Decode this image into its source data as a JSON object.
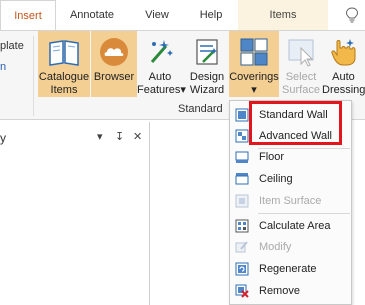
{
  "tabs": [
    {
      "label": "Insert",
      "active": true
    },
    {
      "label": "Annotate"
    },
    {
      "label": "View"
    },
    {
      "label": "Help"
    },
    {
      "label": "Items"
    }
  ],
  "left_stub": {
    "line1": "plate",
    "line2": "n"
  },
  "ribbon": {
    "buttons": [
      {
        "label": "Catalogue\nItems"
      },
      {
        "label": "Browser"
      },
      {
        "label": "Auto\nFeatures▾"
      },
      {
        "label": "Design\nWizard"
      },
      {
        "label": "Coverings\n▾"
      },
      {
        "label": "Select\nSurface"
      },
      {
        "label": "Auto\nDressing"
      }
    ],
    "group_label": "Standard"
  },
  "panel": {
    "title": "y",
    "tools": [
      "▾",
      "↧",
      "✕"
    ]
  },
  "menu": {
    "items": [
      {
        "label": "Standard Wall",
        "icon": "standard-wall-icon"
      },
      {
        "label": "Advanced Wall",
        "icon": "advanced-wall-icon"
      },
      {
        "label": "Floor",
        "icon": "floor-icon"
      },
      {
        "label": "Ceiling",
        "icon": "ceiling-icon"
      },
      {
        "label": "Item Surface",
        "icon": "item-surface-icon",
        "disabled": true
      },
      {
        "label": "Calculate Area",
        "icon": "calculate-area-icon"
      },
      {
        "label": "Modify",
        "icon": "modify-icon",
        "disabled": true
      },
      {
        "label": "Regenerate",
        "icon": "regenerate-icon"
      },
      {
        "label": "Remove",
        "icon": "remove-icon"
      }
    ]
  },
  "colors": {
    "accent": "#c8551e",
    "highlight": "#f3cf94",
    "annotation": "#e2141c"
  }
}
